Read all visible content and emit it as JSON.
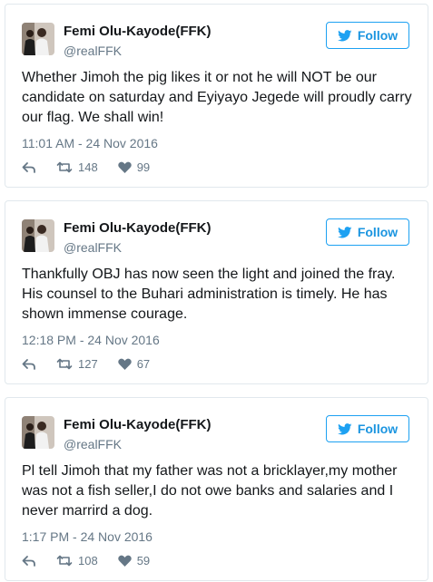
{
  "tweets": [
    {
      "author": "Femi Olu-Kayode(FFK)",
      "handle": "@realFFK",
      "follow_label": "Follow",
      "text": "Whether Jimoh the pig likes it or not he will NOT be our candidate on saturday and Eyiyayo Jegede will proudly carry our flag. We shall win!",
      "timestamp": "11:01 AM - 24 Nov 2016",
      "retweets": "148",
      "likes": "99"
    },
    {
      "author": "Femi Olu-Kayode(FFK)",
      "handle": "@realFFK",
      "follow_label": "Follow",
      "text": "Thankfully OBJ has now seen the light and joined the fray. His counsel to the Buhari administration is timely. He has shown immense courage.",
      "timestamp": "12:18 PM - 24 Nov 2016",
      "retweets": "127",
      "likes": "67"
    },
    {
      "author": "Femi Olu-Kayode(FFK)",
      "handle": "@realFFK",
      "follow_label": "Follow",
      "text": "Pl tell Jimoh that my father was not a bricklayer,my mother was not a fish seller,I do not owe banks and salaries and I never marrird a dog.",
      "timestamp": "1:17 PM - 24 Nov 2016",
      "retweets": "108",
      "likes": "59"
    }
  ],
  "icons": {
    "bird": "twitter-bird-icon",
    "reply": "reply-icon",
    "retweet": "retweet-icon",
    "like": "heart-icon"
  },
  "colors": {
    "brand_blue": "#1da1f2",
    "text": "#14171a",
    "muted": "#657786",
    "border": "#e1e8ed"
  }
}
